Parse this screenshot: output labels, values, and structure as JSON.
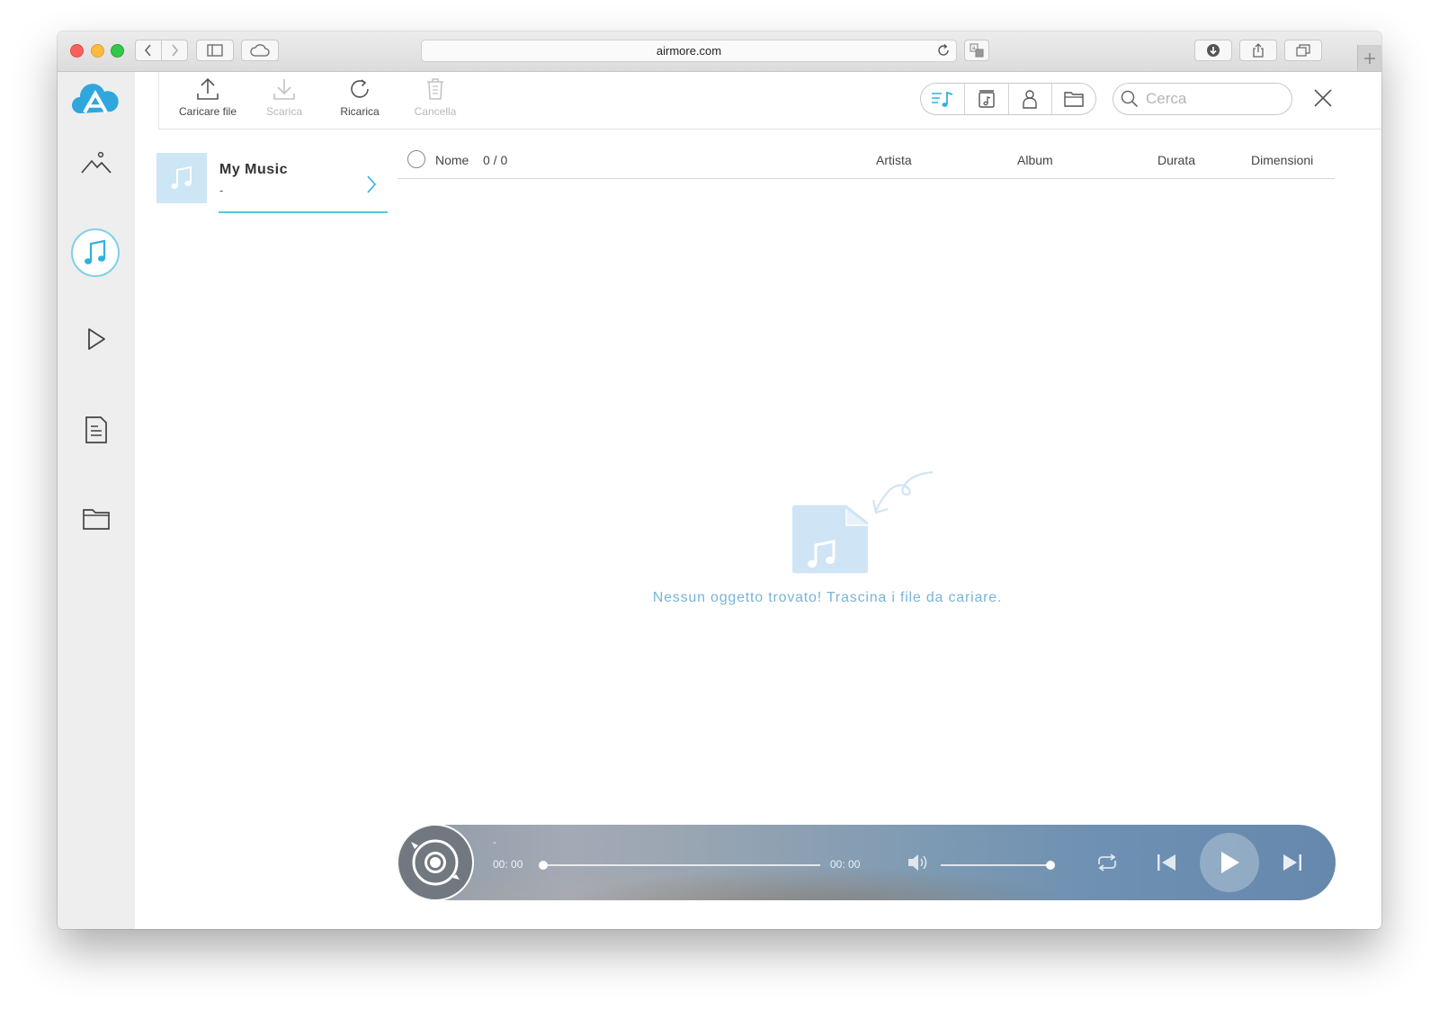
{
  "browser": {
    "url": "airmore.com"
  },
  "toolbar": {
    "upload_label": "Caricare file",
    "download_label": "Scarica",
    "reload_label": "Ricarica",
    "delete_label": "Cancella"
  },
  "search": {
    "placeholder": "Cerca"
  },
  "playlist": {
    "title": "My Music",
    "subtitle": "-"
  },
  "table": {
    "selection_count": "0 / 0",
    "columns": [
      "Nome",
      "Artista",
      "Album",
      "Durata",
      "Dimensioni"
    ]
  },
  "empty_state": {
    "message": "Nessun oggetto trovato! Trascina i file da cariare."
  },
  "player": {
    "track_title": "-",
    "elapsed": "00: 00",
    "total": "00: 00",
    "progress_fraction": 0,
    "volume_fraction": 1
  },
  "colors": {
    "accent": "#3fb6e0",
    "empty_text": "#7ab4d8",
    "icon_light_blue": "#cde6f5"
  }
}
